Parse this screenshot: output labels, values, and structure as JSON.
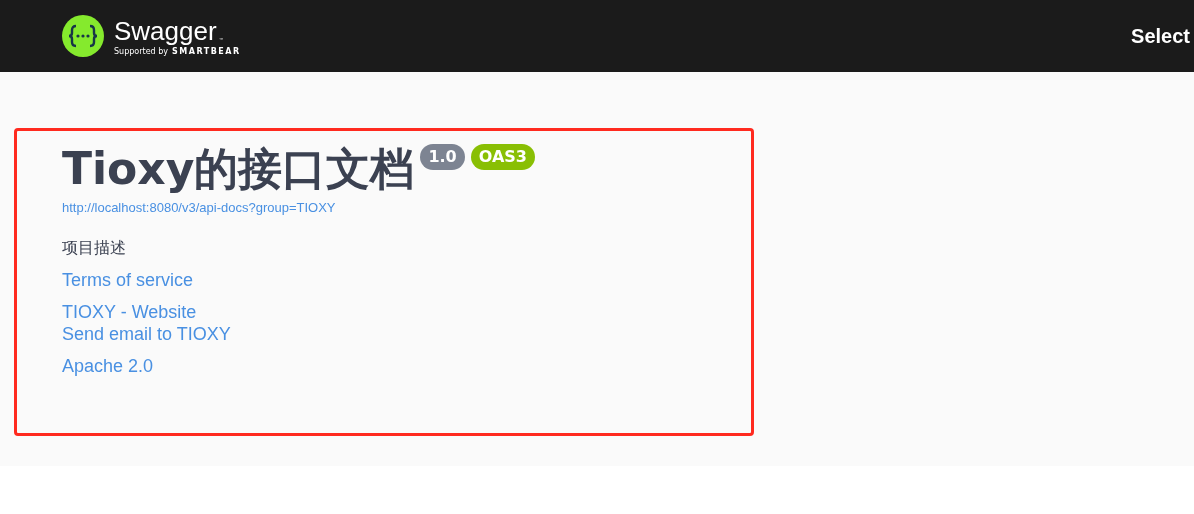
{
  "header": {
    "brand": "Swagger",
    "tagline_prefix": "Supported by",
    "tagline_brand": "SMARTBEAR",
    "trademark": "™",
    "select_label": "Select"
  },
  "info": {
    "title": "Tioxy的接口文档",
    "version": "1.0",
    "spec_badge": "OAS3",
    "url": "http://localhost:8080/v3/api-docs?group=TIOXY",
    "description": "项目描述",
    "link_groups": [
      {
        "links": [
          "Terms of service"
        ]
      },
      {
        "links": [
          "TIOXY - Website",
          "Send email to TIOXY"
        ]
      },
      {
        "links": [
          "Apache 2.0"
        ]
      }
    ]
  }
}
